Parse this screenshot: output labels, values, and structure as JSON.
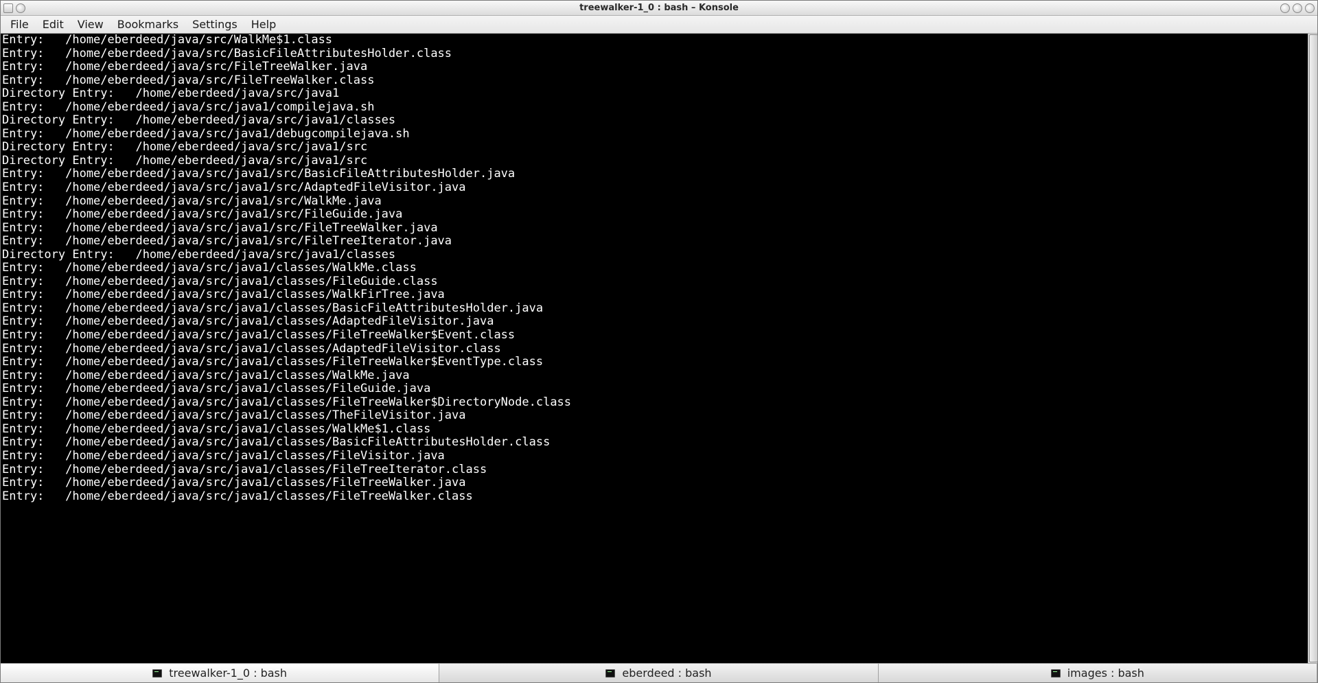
{
  "window": {
    "title": "treewalker-1_0 : bash – Konsole"
  },
  "menu": {
    "items": [
      "File",
      "Edit",
      "View",
      "Bookmarks",
      "Settings",
      "Help"
    ]
  },
  "terminal": {
    "lines": [
      "Entry:   /home/eberdeed/java/src/WalkMe$1.class",
      "Entry:   /home/eberdeed/java/src/BasicFileAttributesHolder.class",
      "Entry:   /home/eberdeed/java/src/FileTreeWalker.java",
      "Entry:   /home/eberdeed/java/src/FileTreeWalker.class",
      "Directory Entry:   /home/eberdeed/java/src/java1",
      "Entry:   /home/eberdeed/java/src/java1/compilejava.sh",
      "Directory Entry:   /home/eberdeed/java/src/java1/classes",
      "Entry:   /home/eberdeed/java/src/java1/debugcompilejava.sh",
      "Directory Entry:   /home/eberdeed/java/src/java1/src",
      "Directory Entry:   /home/eberdeed/java/src/java1/src",
      "Entry:   /home/eberdeed/java/src/java1/src/BasicFileAttributesHolder.java",
      "Entry:   /home/eberdeed/java/src/java1/src/AdaptedFileVisitor.java",
      "Entry:   /home/eberdeed/java/src/java1/src/WalkMe.java",
      "Entry:   /home/eberdeed/java/src/java1/src/FileGuide.java",
      "Entry:   /home/eberdeed/java/src/java1/src/FileTreeWalker.java",
      "Entry:   /home/eberdeed/java/src/java1/src/FileTreeIterator.java",
      "Directory Entry:   /home/eberdeed/java/src/java1/classes",
      "Entry:   /home/eberdeed/java/src/java1/classes/WalkMe.class",
      "Entry:   /home/eberdeed/java/src/java1/classes/FileGuide.class",
      "Entry:   /home/eberdeed/java/src/java1/classes/WalkFirTree.java",
      "Entry:   /home/eberdeed/java/src/java1/classes/BasicFileAttributesHolder.java",
      "Entry:   /home/eberdeed/java/src/java1/classes/AdaptedFileVisitor.java",
      "Entry:   /home/eberdeed/java/src/java1/classes/FileTreeWalker$Event.class",
      "Entry:   /home/eberdeed/java/src/java1/classes/AdaptedFileVisitor.class",
      "Entry:   /home/eberdeed/java/src/java1/classes/FileTreeWalker$EventType.class",
      "Entry:   /home/eberdeed/java/src/java1/classes/WalkMe.java",
      "Entry:   /home/eberdeed/java/src/java1/classes/FileGuide.java",
      "Entry:   /home/eberdeed/java/src/java1/classes/FileTreeWalker$DirectoryNode.class",
      "Entry:   /home/eberdeed/java/src/java1/classes/TheFileVisitor.java",
      "Entry:   /home/eberdeed/java/src/java1/classes/WalkMe$1.class",
      "Entry:   /home/eberdeed/java/src/java1/classes/BasicFileAttributesHolder.class",
      "Entry:   /home/eberdeed/java/src/java1/classes/FileVisitor.java",
      "Entry:   /home/eberdeed/java/src/java1/classes/FileTreeIterator.class",
      "Entry:   /home/eberdeed/java/src/java1/classes/FileTreeWalker.java",
      "Entry:   /home/eberdeed/java/src/java1/classes/FileTreeWalker.class"
    ]
  },
  "tabs": {
    "items": [
      {
        "label": "treewalker-1_0 : bash",
        "active": true
      },
      {
        "label": "eberdeed : bash",
        "active": false
      },
      {
        "label": "images : bash",
        "active": false
      }
    ]
  }
}
